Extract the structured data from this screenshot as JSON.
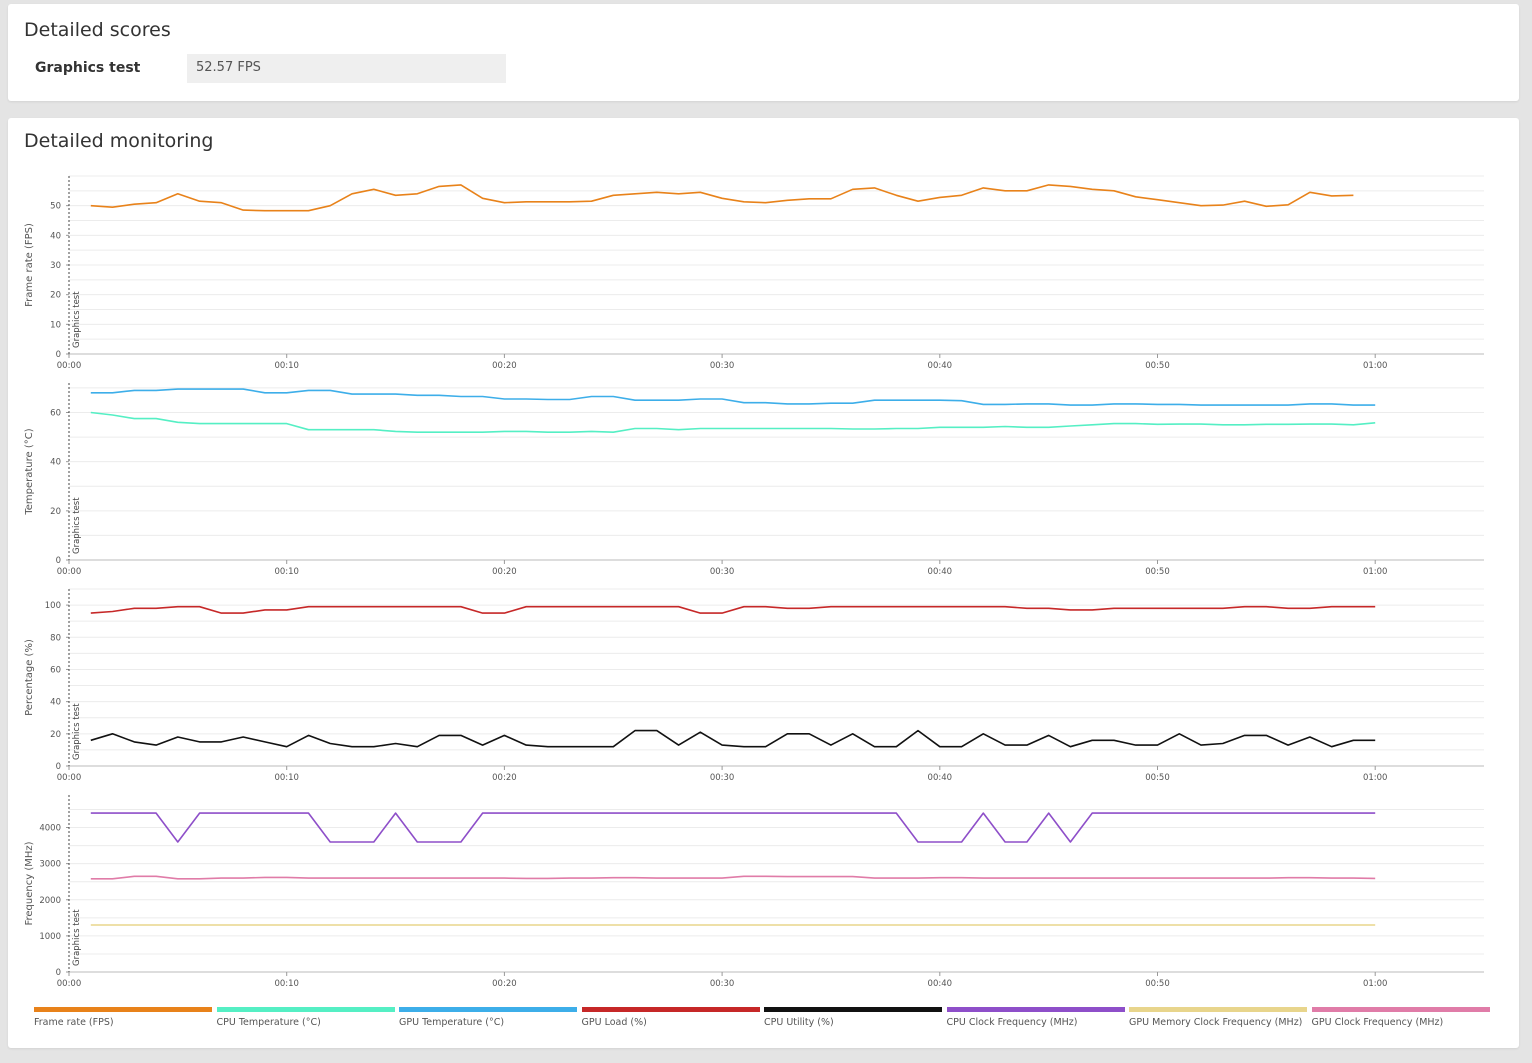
{
  "scores": {
    "title": "Detailed scores",
    "graphics_test_label": "Graphics test",
    "graphics_test_value": "52.57 FPS"
  },
  "monitoring": {
    "title": "Detailed monitoring",
    "marker_label": "Graphics test"
  },
  "colors": {
    "frame_rate": "#e8821a",
    "cpu_temperature": "#55efc4",
    "gpu_temperature": "#3daee9",
    "gpu_load": "#c62828",
    "cpu_utility": "#111111",
    "cpu_clock": "#8e4fc9",
    "gpu_mem_clock": "#e8d58c",
    "gpu_clock": "#e07ca8"
  },
  "legend": [
    {
      "label": "Frame rate (FPS)",
      "color": "#e8821a"
    },
    {
      "label": "CPU Temperature (°C)",
      "color": "#55efc4"
    },
    {
      "label": "GPU Temperature (°C)",
      "color": "#3daee9"
    },
    {
      "label": "GPU Load (%)",
      "color": "#c62828"
    },
    {
      "label": "CPU Utility (%)",
      "color": "#111111"
    },
    {
      "label": "CPU Clock Frequency (MHz)",
      "color": "#8e4fc9"
    },
    {
      "label": "GPU Memory Clock Frequency (MHz)",
      "color": "#e8d58c"
    },
    {
      "label": "GPU Clock Frequency (MHz)",
      "color": "#e07ca8"
    }
  ],
  "chart_data": [
    {
      "type": "line",
      "ylabel": "Frame rate (FPS)",
      "ylim": [
        0,
        60
      ],
      "yticks": [
        0,
        10,
        20,
        30,
        40,
        50
      ],
      "xlim": [
        0,
        65
      ],
      "xticks": [
        "00:00",
        "00:10",
        "00:20",
        "00:30",
        "00:40",
        "00:50",
        "01:00"
      ],
      "grid": true,
      "x": [
        1,
        2,
        3,
        4,
        5,
        6,
        7,
        8,
        9,
        10,
        11,
        12,
        13,
        14,
        15,
        16,
        17,
        18,
        19,
        20,
        21,
        22,
        23,
        24,
        25,
        26,
        27,
        28,
        29,
        30,
        31,
        32,
        33,
        34,
        35,
        36,
        37,
        38,
        39,
        40,
        41,
        42,
        43,
        44,
        45,
        46,
        47,
        48,
        49,
        50,
        51,
        52,
        53,
        54,
        55,
        56,
        57,
        58,
        59
      ],
      "series": [
        {
          "name": "Frame rate (FPS)",
          "color": "#e8821a",
          "values": [
            50,
            49.5,
            50.5,
            51,
            54,
            51.5,
            51,
            48.5,
            48.3,
            48.3,
            48.3,
            50,
            54,
            55.5,
            53.5,
            54,
            56.5,
            57,
            52.5,
            51,
            51.3,
            51.3,
            51.3,
            51.5,
            53.5,
            54,
            54.5,
            54,
            54.5,
            52.5,
            51.3,
            51,
            51.8,
            52.3,
            52.3,
            55.5,
            56,
            53.5,
            51.5,
            52.8,
            53.5,
            56,
            55,
            55,
            57,
            56.5,
            55.5,
            55,
            53,
            52,
            51,
            50,
            50.2,
            51.5,
            49.8,
            50.3,
            54.5,
            53.3,
            53.5
          ]
        }
      ]
    },
    {
      "type": "line",
      "ylabel": "Temperature (°C)",
      "ylim": [
        0,
        72
      ],
      "yticks": [
        0,
        20,
        40,
        60
      ],
      "xlim": [
        0,
        65
      ],
      "xticks": [
        "00:00",
        "00:10",
        "00:20",
        "00:30",
        "00:40",
        "00:50",
        "01:00"
      ],
      "grid": true,
      "x": [
        1,
        2,
        3,
        4,
        5,
        6,
        7,
        8,
        9,
        10,
        11,
        12,
        13,
        14,
        15,
        16,
        17,
        18,
        19,
        20,
        21,
        22,
        23,
        24,
        25,
        26,
        27,
        28,
        29,
        30,
        31,
        32,
        33,
        34,
        35,
        36,
        37,
        38,
        39,
        40,
        41,
        42,
        43,
        44,
        45,
        46,
        47,
        48,
        49,
        50,
        51,
        52,
        53,
        54,
        55,
        56,
        57,
        58,
        59,
        60
      ],
      "series": [
        {
          "name": "GPU Temperature (°C)",
          "color": "#3daee9",
          "values": [
            68,
            68,
            69,
            69,
            69.5,
            69.5,
            69.5,
            69.5,
            68,
            68,
            69,
            69,
            67.5,
            67.5,
            67.5,
            67,
            67,
            66.5,
            66.5,
            65.5,
            65.5,
            65.3,
            65.3,
            66.5,
            66.5,
            65,
            65,
            65,
            65.5,
            65.5,
            64,
            64,
            63.5,
            63.5,
            63.8,
            63.8,
            65,
            65,
            65,
            65,
            64.8,
            63.3,
            63.3,
            63.5,
            63.5,
            63,
            63,
            63.5,
            63.5,
            63.3,
            63.3,
            63,
            63,
            63,
            63,
            63,
            63.5,
            63.5,
            63,
            63
          ]
        },
        {
          "name": "CPU Temperature (°C)",
          "color": "#55efc4",
          "values": [
            60,
            59,
            57.5,
            57.5,
            56,
            55.5,
            55.5,
            55.5,
            55.5,
            55.5,
            53,
            53,
            53,
            53,
            52.3,
            52,
            52,
            52,
            52,
            52.3,
            52.3,
            52,
            52,
            52.3,
            52,
            53.5,
            53.5,
            53,
            53.5,
            53.5,
            53.5,
            53.5,
            53.5,
            53.5,
            53.5,
            53.3,
            53.3,
            53.5,
            53.5,
            54,
            54,
            54,
            54.3,
            54,
            54,
            54.5,
            55,
            55.5,
            55.5,
            55.2,
            55.3,
            55.3,
            55,
            55,
            55.2,
            55.2,
            55.3,
            55.3,
            55,
            55.8
          ]
        }
      ]
    },
    {
      "type": "line",
      "ylabel": "Percentage (%)",
      "ylim": [
        0,
        110
      ],
      "yticks": [
        0,
        20,
        40,
        60,
        80,
        100
      ],
      "xlim": [
        0,
        65
      ],
      "xticks": [
        "00:00",
        "00:10",
        "00:20",
        "00:30",
        "00:40",
        "00:50",
        "01:00"
      ],
      "grid": true,
      "x": [
        1,
        2,
        3,
        4,
        5,
        6,
        7,
        8,
        9,
        10,
        11,
        12,
        13,
        14,
        15,
        16,
        17,
        18,
        19,
        20,
        21,
        22,
        23,
        24,
        25,
        26,
        27,
        28,
        29,
        30,
        31,
        32,
        33,
        34,
        35,
        36,
        37,
        38,
        39,
        40,
        41,
        42,
        43,
        44,
        45,
        46,
        47,
        48,
        49,
        50,
        51,
        52,
        53,
        54,
        55,
        56,
        57,
        58,
        59,
        60
      ],
      "series": [
        {
          "name": "GPU Load (%)",
          "color": "#c62828",
          "values": [
            95,
            96,
            98,
            98,
            99,
            99,
            95,
            95,
            97,
            97,
            99,
            99,
            99,
            99,
            99,
            99,
            99,
            99,
            95,
            95,
            99,
            99,
            99,
            99,
            99,
            99,
            99,
            99,
            95,
            95,
            99,
            99,
            98,
            98,
            99,
            99,
            99,
            99,
            99,
            99,
            99,
            99,
            99,
            98,
            98,
            97,
            97,
            98,
            98,
            98,
            98,
            98,
            98,
            99,
            99,
            98,
            98,
            99,
            99,
            99
          ]
        },
        {
          "name": "CPU Utility (%)",
          "color": "#111111",
          "values": [
            16,
            20,
            15,
            13,
            18,
            15,
            15,
            18,
            15,
            12,
            19,
            14,
            12,
            12,
            14,
            12,
            19,
            19,
            13,
            19,
            13,
            12,
            12,
            12,
            12,
            22,
            22,
            13,
            21,
            13,
            12,
            12,
            20,
            20,
            13,
            20,
            12,
            12,
            22,
            12,
            12,
            20,
            13,
            13,
            19,
            12,
            16,
            16,
            13,
            13,
            20,
            13,
            14,
            19,
            19,
            13,
            18,
            12,
            16,
            16
          ]
        }
      ]
    },
    {
      "type": "line",
      "ylabel": "Frequency (MHz)",
      "ylim": [
        0,
        4900
      ],
      "yticks": [
        0,
        1000,
        2000,
        3000,
        4000
      ],
      "xlim": [
        0,
        65
      ],
      "xticks": [
        "00:00",
        "00:10",
        "00:20",
        "00:30",
        "00:40",
        "00:50",
        "01:00"
      ],
      "grid": true,
      "x": [
        1,
        2,
        3,
        4,
        5,
        6,
        7,
        8,
        9,
        10,
        11,
        12,
        13,
        14,
        15,
        16,
        17,
        18,
        19,
        20,
        21,
        22,
        23,
        24,
        25,
        26,
        27,
        28,
        29,
        30,
        31,
        32,
        33,
        34,
        35,
        36,
        37,
        38,
        39,
        40,
        41,
        42,
        43,
        44,
        45,
        46,
        47,
        48,
        49,
        50,
        51,
        52,
        53,
        54,
        55,
        56,
        57,
        58,
        59,
        60
      ],
      "series": [
        {
          "name": "CPU Clock Frequency (MHz)",
          "color": "#8e4fc9",
          "values": [
            4400,
            4400,
            4400,
            4400,
            3600,
            4400,
            4400,
            4400,
            4400,
            4400,
            4400,
            3600,
            3600,
            3600,
            4400,
            3600,
            3600,
            3600,
            4400,
            4400,
            4400,
            4400,
            4400,
            4400,
            4400,
            4400,
            4400,
            4400,
            4400,
            4400,
            4400,
            4400,
            4400,
            4400,
            4400,
            4400,
            4400,
            4400,
            3600,
            3600,
            3600,
            4400,
            3600,
            3600,
            4400,
            3600,
            4400,
            4400,
            4400,
            4400,
            4400,
            4400,
            4400,
            4400,
            4400,
            4400,
            4400,
            4400,
            4400,
            4400
          ]
        },
        {
          "name": "GPU Clock Frequency (MHz)",
          "color": "#e07ca8",
          "values": [
            2580,
            2580,
            2650,
            2650,
            2580,
            2580,
            2600,
            2600,
            2620,
            2620,
            2600,
            2600,
            2600,
            2600,
            2600,
            2600,
            2600,
            2600,
            2600,
            2600,
            2590,
            2590,
            2600,
            2600,
            2610,
            2610,
            2600,
            2600,
            2600,
            2600,
            2650,
            2650,
            2640,
            2640,
            2640,
            2640,
            2600,
            2600,
            2600,
            2610,
            2610,
            2600,
            2600,
            2600,
            2600,
            2600,
            2600,
            2600,
            2600,
            2600,
            2600,
            2600,
            2600,
            2600,
            2600,
            2610,
            2610,
            2600,
            2600,
            2590
          ]
        },
        {
          "name": "GPU Memory Clock Frequency (MHz)",
          "color": "#e8d58c",
          "values": [
            1300,
            1300,
            1300,
            1300,
            1300,
            1300,
            1300,
            1300,
            1300,
            1300,
            1300,
            1300,
            1300,
            1300,
            1300,
            1300,
            1300,
            1300,
            1300,
            1300,
            1300,
            1300,
            1300,
            1300,
            1300,
            1300,
            1300,
            1300,
            1300,
            1300,
            1300,
            1300,
            1300,
            1300,
            1300,
            1300,
            1300,
            1300,
            1300,
            1300,
            1300,
            1300,
            1300,
            1300,
            1300,
            1300,
            1300,
            1300,
            1300,
            1300,
            1300,
            1300,
            1300,
            1300,
            1300,
            1300,
            1300,
            1300,
            1300,
            1300
          ]
        }
      ]
    }
  ]
}
